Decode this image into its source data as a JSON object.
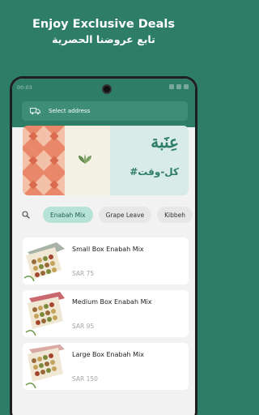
{
  "promo": {
    "title": "Enjoy Exclusive Deals",
    "subtitle": "تابع عروضنا الحصرية"
  },
  "status_bar": {
    "time": "00:03",
    "color": "#2e7d67"
  },
  "header": {
    "address_placeholder": "Select address",
    "icon": "delivery-truck-icon"
  },
  "banner": {
    "title_ar": "عِنَبة",
    "tagline_ar": "#كل-وقت",
    "icon": "leaf-icon"
  },
  "filters": {
    "search_icon": "search-icon",
    "chips": [
      {
        "label": "Enabah Mix",
        "active": true
      },
      {
        "label": "Grape Leave",
        "active": false
      },
      {
        "label": "Kibbeh",
        "active": false
      }
    ]
  },
  "products": [
    {
      "name": "Small Box Enabah Mix",
      "price": "SAR 75",
      "box_color": "#a7b3a6"
    },
    {
      "name": "Medium Box Enabah Mix",
      "price": "SAR 95",
      "box_color": "#c9696f"
    },
    {
      "name": "Large Box Enabah Mix",
      "price": "SAR 150",
      "box_color": "#d9a9a4"
    }
  ],
  "colors": {
    "brand": "#2e7d67",
    "chip_active": "#b6e3d6",
    "card_bg": "#ffffff"
  }
}
